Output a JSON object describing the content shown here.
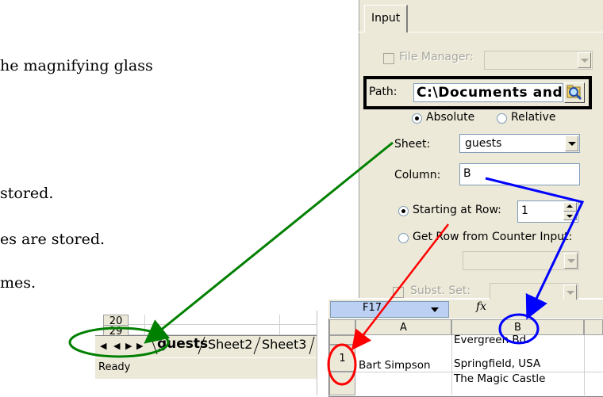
{
  "doc_text": {
    "line1": "he magnifying glass",
    "line2": "stored.",
    "line3": "es are stored.",
    "line4": "mes."
  },
  "panel": {
    "tab_label": "Input",
    "file_manager_label": "File Manager:",
    "path_label": "Path:",
    "path_value": "C:\\Documents and",
    "absolute_label": "Absolute",
    "relative_label": "Relative",
    "sheet_label": "Sheet:",
    "sheet_value": "guests",
    "column_label": "Column:",
    "column_value": "B",
    "starting_row_label": "Starting at Row:",
    "starting_row_value": "1",
    "get_row_label": "Get Row from Counter Input:",
    "subst_set_label": "Subst. Set:"
  },
  "sheet_tabs": {
    "row_numbers": [
      "20",
      "29"
    ],
    "tabs": [
      "guests",
      "Sheet2",
      "Sheet3"
    ],
    "active_tab": "guests",
    "status": "Ready"
  },
  "spreadsheet": {
    "name_box": "F17",
    "fx_label": "fx",
    "columns": [
      "A",
      "B"
    ],
    "rows": [
      {
        "row_number": "1",
        "a": "Bart Simpson",
        "b_lines": [
          "Evergreen Bd.",
          "Springfield, USA"
        ]
      }
    ],
    "next_row_b": "The Magic Castle"
  },
  "colors": {
    "panel_bg": "#ece9d8",
    "highlight_black": "#000000",
    "arrow_green": "#008000",
    "arrow_blue": "#0000ff",
    "arrow_red": "#ff0000"
  }
}
